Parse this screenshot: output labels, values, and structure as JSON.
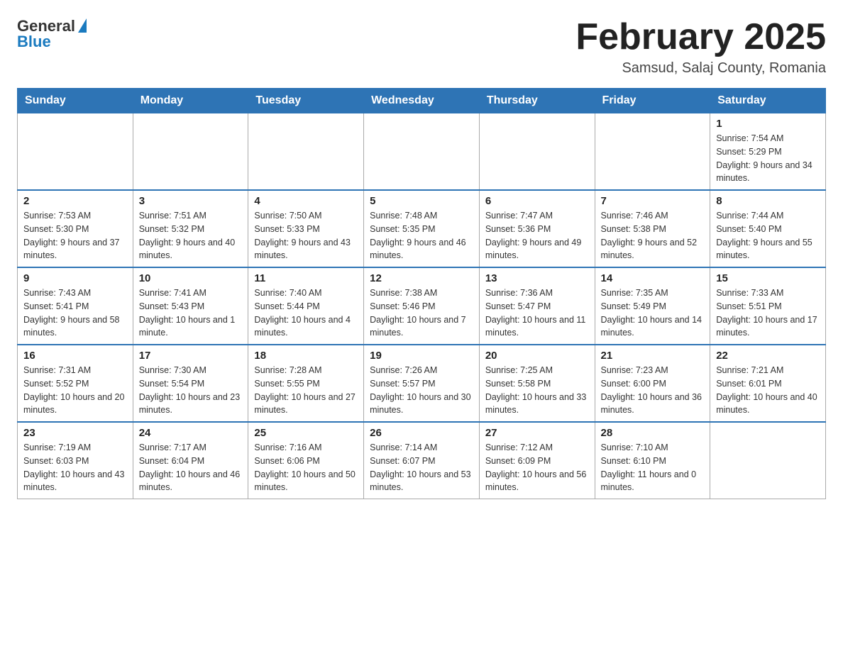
{
  "header": {
    "logo": {
      "general_text": "General",
      "blue_text": "Blue"
    },
    "title": "February 2025",
    "location": "Samsud, Salaj County, Romania"
  },
  "calendar": {
    "days_of_week": [
      "Sunday",
      "Monday",
      "Tuesday",
      "Wednesday",
      "Thursday",
      "Friday",
      "Saturday"
    ],
    "weeks": [
      [
        {
          "day": "",
          "info": ""
        },
        {
          "day": "",
          "info": ""
        },
        {
          "day": "",
          "info": ""
        },
        {
          "day": "",
          "info": ""
        },
        {
          "day": "",
          "info": ""
        },
        {
          "day": "",
          "info": ""
        },
        {
          "day": "1",
          "info": "Sunrise: 7:54 AM\nSunset: 5:29 PM\nDaylight: 9 hours and 34 minutes."
        }
      ],
      [
        {
          "day": "2",
          "info": "Sunrise: 7:53 AM\nSunset: 5:30 PM\nDaylight: 9 hours and 37 minutes."
        },
        {
          "day": "3",
          "info": "Sunrise: 7:51 AM\nSunset: 5:32 PM\nDaylight: 9 hours and 40 minutes."
        },
        {
          "day": "4",
          "info": "Sunrise: 7:50 AM\nSunset: 5:33 PM\nDaylight: 9 hours and 43 minutes."
        },
        {
          "day": "5",
          "info": "Sunrise: 7:48 AM\nSunset: 5:35 PM\nDaylight: 9 hours and 46 minutes."
        },
        {
          "day": "6",
          "info": "Sunrise: 7:47 AM\nSunset: 5:36 PM\nDaylight: 9 hours and 49 minutes."
        },
        {
          "day": "7",
          "info": "Sunrise: 7:46 AM\nSunset: 5:38 PM\nDaylight: 9 hours and 52 minutes."
        },
        {
          "day": "8",
          "info": "Sunrise: 7:44 AM\nSunset: 5:40 PM\nDaylight: 9 hours and 55 minutes."
        }
      ],
      [
        {
          "day": "9",
          "info": "Sunrise: 7:43 AM\nSunset: 5:41 PM\nDaylight: 9 hours and 58 minutes."
        },
        {
          "day": "10",
          "info": "Sunrise: 7:41 AM\nSunset: 5:43 PM\nDaylight: 10 hours and 1 minute."
        },
        {
          "day": "11",
          "info": "Sunrise: 7:40 AM\nSunset: 5:44 PM\nDaylight: 10 hours and 4 minutes."
        },
        {
          "day": "12",
          "info": "Sunrise: 7:38 AM\nSunset: 5:46 PM\nDaylight: 10 hours and 7 minutes."
        },
        {
          "day": "13",
          "info": "Sunrise: 7:36 AM\nSunset: 5:47 PM\nDaylight: 10 hours and 11 minutes."
        },
        {
          "day": "14",
          "info": "Sunrise: 7:35 AM\nSunset: 5:49 PM\nDaylight: 10 hours and 14 minutes."
        },
        {
          "day": "15",
          "info": "Sunrise: 7:33 AM\nSunset: 5:51 PM\nDaylight: 10 hours and 17 minutes."
        }
      ],
      [
        {
          "day": "16",
          "info": "Sunrise: 7:31 AM\nSunset: 5:52 PM\nDaylight: 10 hours and 20 minutes."
        },
        {
          "day": "17",
          "info": "Sunrise: 7:30 AM\nSunset: 5:54 PM\nDaylight: 10 hours and 23 minutes."
        },
        {
          "day": "18",
          "info": "Sunrise: 7:28 AM\nSunset: 5:55 PM\nDaylight: 10 hours and 27 minutes."
        },
        {
          "day": "19",
          "info": "Sunrise: 7:26 AM\nSunset: 5:57 PM\nDaylight: 10 hours and 30 minutes."
        },
        {
          "day": "20",
          "info": "Sunrise: 7:25 AM\nSunset: 5:58 PM\nDaylight: 10 hours and 33 minutes."
        },
        {
          "day": "21",
          "info": "Sunrise: 7:23 AM\nSunset: 6:00 PM\nDaylight: 10 hours and 36 minutes."
        },
        {
          "day": "22",
          "info": "Sunrise: 7:21 AM\nSunset: 6:01 PM\nDaylight: 10 hours and 40 minutes."
        }
      ],
      [
        {
          "day": "23",
          "info": "Sunrise: 7:19 AM\nSunset: 6:03 PM\nDaylight: 10 hours and 43 minutes."
        },
        {
          "day": "24",
          "info": "Sunrise: 7:17 AM\nSunset: 6:04 PM\nDaylight: 10 hours and 46 minutes."
        },
        {
          "day": "25",
          "info": "Sunrise: 7:16 AM\nSunset: 6:06 PM\nDaylight: 10 hours and 50 minutes."
        },
        {
          "day": "26",
          "info": "Sunrise: 7:14 AM\nSunset: 6:07 PM\nDaylight: 10 hours and 53 minutes."
        },
        {
          "day": "27",
          "info": "Sunrise: 7:12 AM\nSunset: 6:09 PM\nDaylight: 10 hours and 56 minutes."
        },
        {
          "day": "28",
          "info": "Sunrise: 7:10 AM\nSunset: 6:10 PM\nDaylight: 11 hours and 0 minutes."
        },
        {
          "day": "",
          "info": ""
        }
      ]
    ]
  }
}
